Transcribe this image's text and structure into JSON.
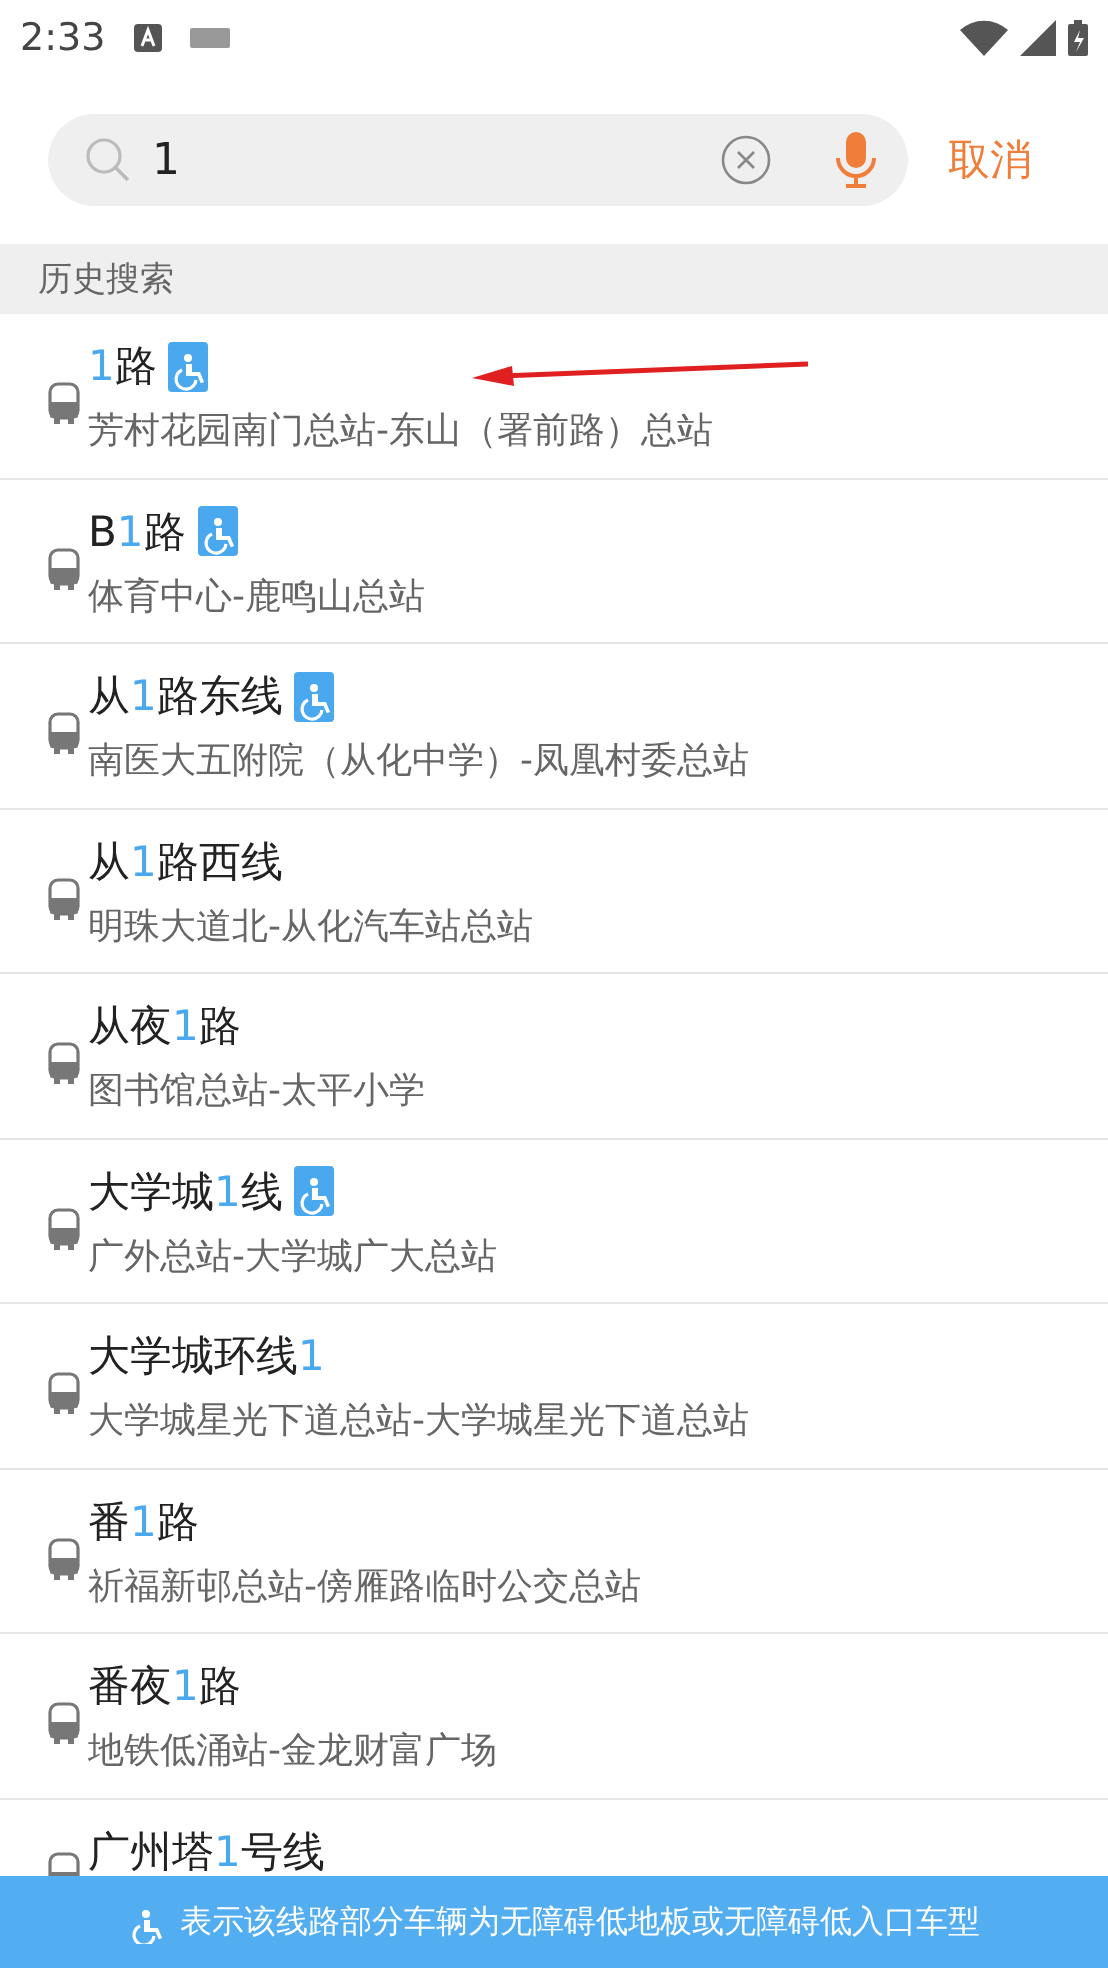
{
  "status_bar": {
    "time": "2:33"
  },
  "search": {
    "value": "1",
    "cancel": "取消"
  },
  "section_title": "历史搜索",
  "routes": [
    {
      "title": [
        {
          "text": "1",
          "highlight": true
        },
        {
          "text": "路",
          "highlight": false
        }
      ],
      "accessible": true,
      "stops": "芳村花园南门总站-东山（署前路）总站"
    },
    {
      "title": [
        {
          "text": "B",
          "highlight": false
        },
        {
          "text": "1",
          "highlight": true
        },
        {
          "text": "路",
          "highlight": false
        }
      ],
      "accessible": true,
      "stops": "体育中心-鹿鸣山总站"
    },
    {
      "title": [
        {
          "text": "从",
          "highlight": false
        },
        {
          "text": "1",
          "highlight": true
        },
        {
          "text": "路东线",
          "highlight": false
        }
      ],
      "accessible": true,
      "stops": "南医大五附院（从化中学）-凤凰村委总站"
    },
    {
      "title": [
        {
          "text": "从",
          "highlight": false
        },
        {
          "text": "1",
          "highlight": true
        },
        {
          "text": "路西线",
          "highlight": false
        }
      ],
      "accessible": false,
      "stops": "明珠大道北-从化汽车站总站"
    },
    {
      "title": [
        {
          "text": "从夜",
          "highlight": false
        },
        {
          "text": "1",
          "highlight": true
        },
        {
          "text": "路",
          "highlight": false
        }
      ],
      "accessible": false,
      "stops": "图书馆总站-太平小学"
    },
    {
      "title": [
        {
          "text": "大学城",
          "highlight": false
        },
        {
          "text": "1",
          "highlight": true
        },
        {
          "text": "线",
          "highlight": false
        }
      ],
      "accessible": true,
      "stops": "广外总站-大学城广大总站"
    },
    {
      "title": [
        {
          "text": "大学城环线",
          "highlight": false
        },
        {
          "text": "1",
          "highlight": true
        }
      ],
      "accessible": false,
      "stops": "大学城星光下道总站-大学城星光下道总站"
    },
    {
      "title": [
        {
          "text": "番",
          "highlight": false
        },
        {
          "text": "1",
          "highlight": true
        },
        {
          "text": "路",
          "highlight": false
        }
      ],
      "accessible": false,
      "stops": "祈福新邨总站-傍雁路临时公交总站"
    },
    {
      "title": [
        {
          "text": "番夜",
          "highlight": false
        },
        {
          "text": "1",
          "highlight": true
        },
        {
          "text": "路",
          "highlight": false
        }
      ],
      "accessible": false,
      "stops": "地铁低涌站-金龙财富广场"
    },
    {
      "title": [
        {
          "text": "广州塔",
          "highlight": false
        },
        {
          "text": "1",
          "highlight": true
        },
        {
          "text": "号线",
          "highlight": false
        }
      ],
      "accessible": false
    }
  ],
  "legend": "表示该线路部分车辆为无障碍低地板或无障碍低入口车型"
}
